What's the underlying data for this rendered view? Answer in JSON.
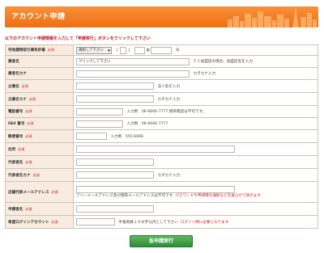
{
  "header": {
    "title": "アカウント申請"
  },
  "notice": "以下のアカウント申請情報を入力して「申請実行」ボタンをクリックして下さい",
  "required_label": "必須",
  "fields": {
    "license": {
      "label": "宅地建物取引業免許番",
      "select_value": "選択して下さい",
      "paren_open": "（",
      "paren_close": "）",
      "number_suffix": "第",
      "number_unit": "号"
    },
    "trade_name": {
      "label": "業者名",
      "value": "クリックして下さい",
      "hint": "ＦＣ加盟店の場合、加盟店名を入力"
    },
    "trade_name_kana": {
      "label": "業者名カナ",
      "hint": "カタカナ入力"
    },
    "company_name": {
      "label": "企業名",
      "hint": "法人名を入力"
    },
    "company_name_kana": {
      "label": "企業名カナ",
      "hint": "カタカナ入力"
    },
    "phone": {
      "label": "電話番号",
      "hint": "入力例　06-6666-7777 携帯電話は不可です。"
    },
    "fax": {
      "label": "FAX 番号",
      "hint": "入力例　06-6666-7777"
    },
    "postal_code": {
      "label": "郵便番号",
      "hint": "入力例　555-6666"
    },
    "address": {
      "label": "住所"
    },
    "representative": {
      "label": "代表者名"
    },
    "representative_kana": {
      "label": "代表者名カナ",
      "hint": "カタカナ入力"
    },
    "email": {
      "label": "店舗代表メールアドレス",
      "hint": "フリーメールアドレス及び携帯メールアドレスは不可です",
      "hint_red": "パスワードや申請時の通知などを送らせて頂きます"
    },
    "applicant": {
      "label": "申請者名"
    },
    "login_account": {
      "label": "希望ログインアカウント",
      "hint": "半角英数１６文字以内として下さい",
      "hint_red": "ログイン時に必要となります"
    }
  },
  "submit_label": "仮申請実行",
  "colors": {
    "header": "#f47b20",
    "label_bg": "#f7ecdf",
    "required": "#d0121b",
    "notice": "#c0181e",
    "submit": "#3a9a3e"
  }
}
